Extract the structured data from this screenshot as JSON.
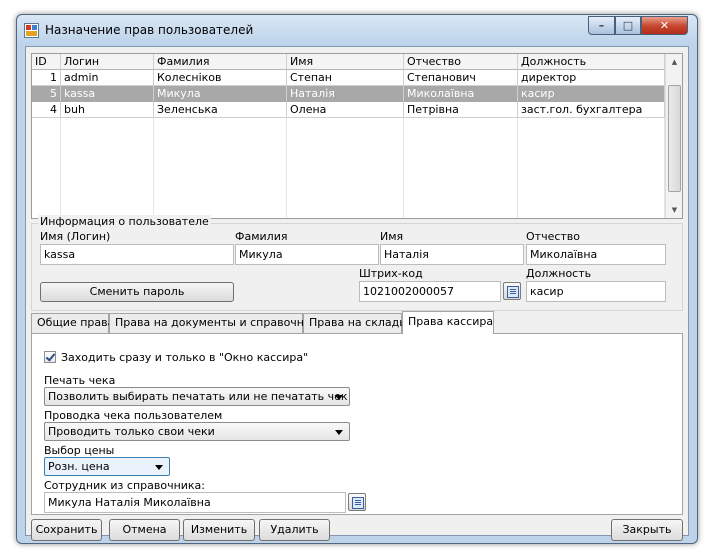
{
  "window": {
    "title": "Назначение прав пользователей"
  },
  "grid": {
    "headers": [
      "ID",
      "Логин",
      "Фамилия",
      "Имя",
      "Отчество",
      "Должность"
    ],
    "rows": [
      [
        "1",
        "admin",
        "Колесніков",
        "Степан",
        "Степанович",
        "директор"
      ],
      [
        "5",
        "kassa",
        "Микула",
        "Наталія",
        "Миколаївна",
        "касир"
      ],
      [
        "4",
        "buh",
        "Зеленська",
        "Олена",
        "Петрівна",
        "заст.гол. бухгалтера"
      ]
    ],
    "selected_row": 1
  },
  "info": {
    "legend": "Информация о пользователе",
    "login_label": "Имя (Логин)",
    "login": "kassa",
    "lastname_label": "Фамилия",
    "lastname": "Микула",
    "firstname_label": "Имя",
    "firstname": "Наталія",
    "patronymic_label": "Отчество",
    "patronymic": "Миколаївна",
    "change_password": "Сменить пароль",
    "barcode_label": "Штрих-код",
    "barcode": "1021002000057",
    "position_label": "Должность",
    "position": "касир"
  },
  "tabs": [
    "Общие права",
    "Права на документы и справочники",
    "Права на склады",
    "Права кассира"
  ],
  "active_tab": 3,
  "cashier": {
    "go_to_cashier_label": "Заходить сразу и только в \"Окно кассира\"",
    "go_to_cashier_checked": true,
    "print_label": "Печать чека",
    "print_value": "Позволить выбирать печатать или не печатать чек",
    "posting_label": "Проводка чека пользователем",
    "posting_value": "Проводить только свои чеки",
    "price_label": "Выбор цены",
    "price_value": "Розн. цена",
    "employee_label": "Сотрудник из справочника:",
    "employee_value": "Микула Наталія Миколаївна"
  },
  "buttons": {
    "save": "Сохранить",
    "cancel": "Отмена",
    "edit": "Изменить",
    "delete": "Удалить",
    "close": "Закрыть"
  },
  "caption": {
    "min": "–",
    "max": "□",
    "close": "✕"
  }
}
